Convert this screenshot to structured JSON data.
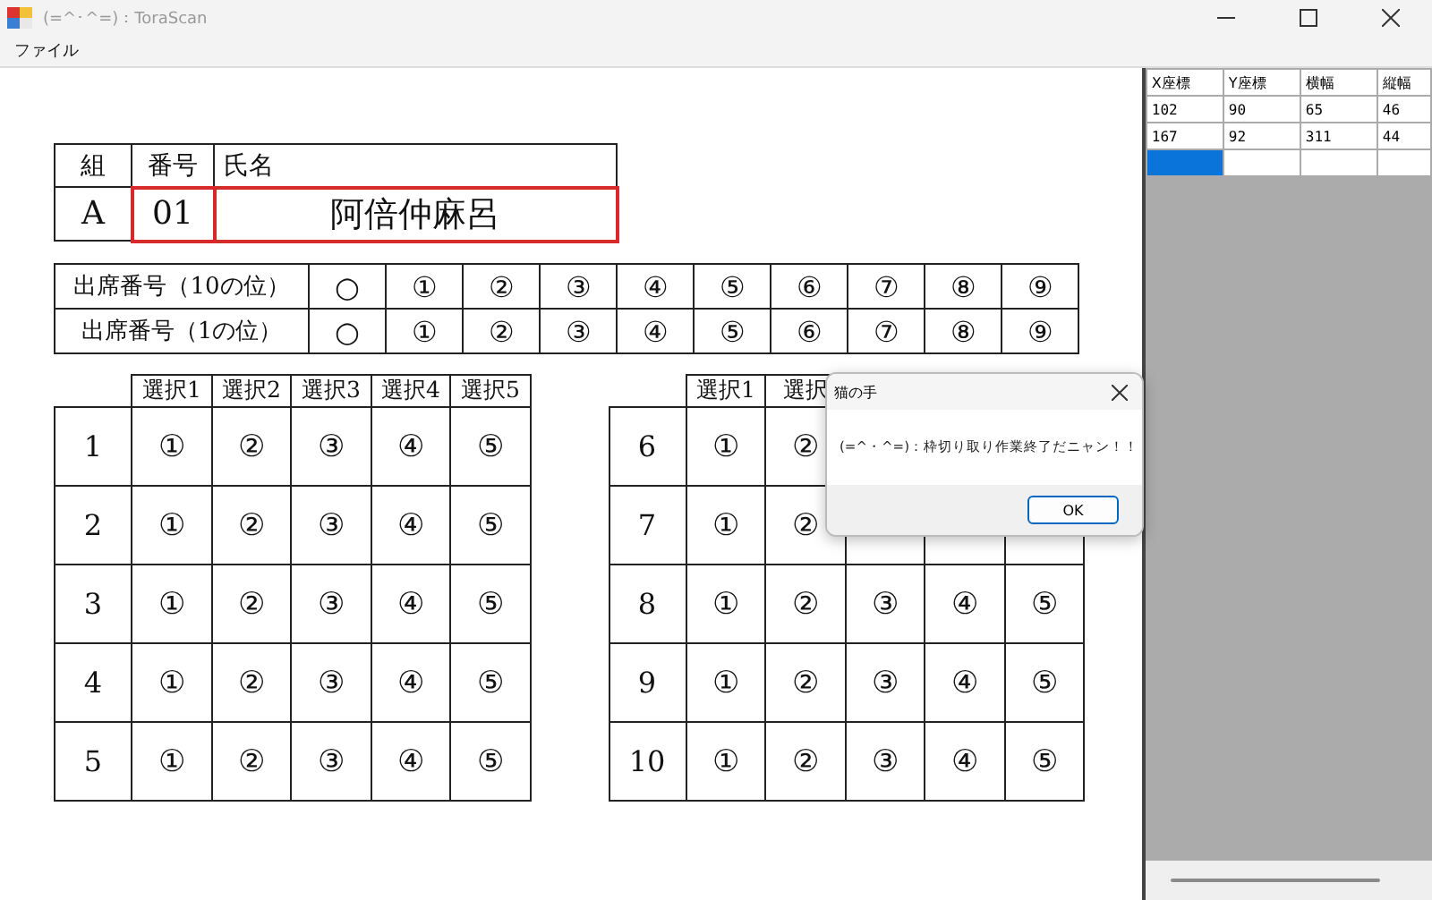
{
  "window": {
    "title": "(=^･^=)：ToraScan"
  },
  "menu": [
    "ファイル"
  ],
  "sheet": {
    "info": {
      "headers": [
        "組",
        "番号",
        "氏名"
      ],
      "values": [
        {
          "text": "A",
          "marked": false
        },
        {
          "text": "01",
          "marked": true
        },
        {
          "text": "阿倍仲麻呂",
          "marked": true
        }
      ]
    },
    "attendance": [
      {
        "label": "出席番号（10の位）",
        "options": [
          "○",
          "①",
          "②",
          "③",
          "④",
          "⑤",
          "⑥",
          "⑦",
          "⑧",
          "⑨"
        ]
      },
      {
        "label": "出席番号（1の位）",
        "options": [
          "○",
          "①",
          "②",
          "③",
          "④",
          "⑤",
          "⑥",
          "⑦",
          "⑧",
          "⑨"
        ]
      }
    ],
    "answer_blocks": [
      {
        "headers": [
          "選択1",
          "選択2",
          "選択3",
          "選択4",
          "選択5"
        ],
        "rows": [
          {
            "number": "1",
            "options": [
              "①",
              "②",
              "③",
              "④",
              "⑤"
            ]
          },
          {
            "number": "2",
            "options": [
              "①",
              "②",
              "③",
              "④",
              "⑤"
            ]
          },
          {
            "number": "3",
            "options": [
              "①",
              "②",
              "③",
              "④",
              "⑤"
            ]
          },
          {
            "number": "4",
            "options": [
              "①",
              "②",
              "③",
              "④",
              "⑤"
            ]
          },
          {
            "number": "5",
            "options": [
              "①",
              "②",
              "③",
              "④",
              "⑤"
            ]
          }
        ]
      },
      {
        "headers": [
          "選択1",
          "選択"
        ],
        "rows": [
          {
            "number": "6",
            "options": [
              "①",
              "②"
            ]
          },
          {
            "number": "7",
            "options": [
              "①",
              "②"
            ]
          },
          {
            "number": "8",
            "options": [
              "①",
              "②",
              "③",
              "④",
              "⑤"
            ]
          },
          {
            "number": "9",
            "options": [
              "①",
              "②",
              "③",
              "④",
              "⑤"
            ]
          },
          {
            "number": "10",
            "options": [
              "①",
              "②",
              "③",
              "④",
              "⑤"
            ]
          }
        ]
      }
    ]
  },
  "grid": {
    "columns": [
      "X座標",
      "Y座標",
      "横幅",
      "縦幅"
    ],
    "rows": [
      {
        "cells": [
          "102",
          "90",
          "65",
          "46"
        ]
      },
      {
        "cells": [
          "167",
          "92",
          "311",
          "44"
        ]
      }
    ],
    "new_row": {
      "selected": true
    }
  },
  "dialog": {
    "title": "猫の手",
    "message": "(=^・^=)：枠切り取り作業終了だニャン！！",
    "button": "OK"
  }
}
